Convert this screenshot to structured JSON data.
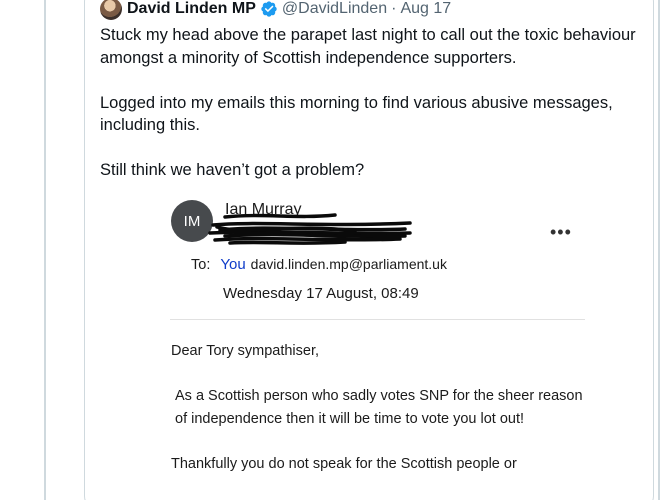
{
  "tweet": {
    "display_name": "David Linden MP",
    "handle": "@DavidLinden",
    "separator": "·",
    "date": "Aug 17",
    "verified_color": "#1d9bf0",
    "paragraphs": [
      "Stuck my head above the parapet last night to call out the toxic behaviour amongst a minority of Scottish independence supporters.",
      "Logged into my emails this morning to find various abusive messages, including this.",
      "Still think we haven’t got a problem?"
    ]
  },
  "email": {
    "avatar_initials": "IM",
    "sender_name": "Ian Murray",
    "more_icon": "more-horizontal-icon",
    "to_label": "To:",
    "to_you": "You",
    "to_address": "david.linden.mp@parliament.uk",
    "date": "Wednesday 17 August, 08:49",
    "body": {
      "greeting": "Dear Tory sympathiser,",
      "paragraph_1": "As a Scottish person who sadly votes SNP for the sheer reason of independence then it will be time to vote you lot out!",
      "paragraph_2": "Thankfully you do not speak for the Scottish people or"
    }
  }
}
